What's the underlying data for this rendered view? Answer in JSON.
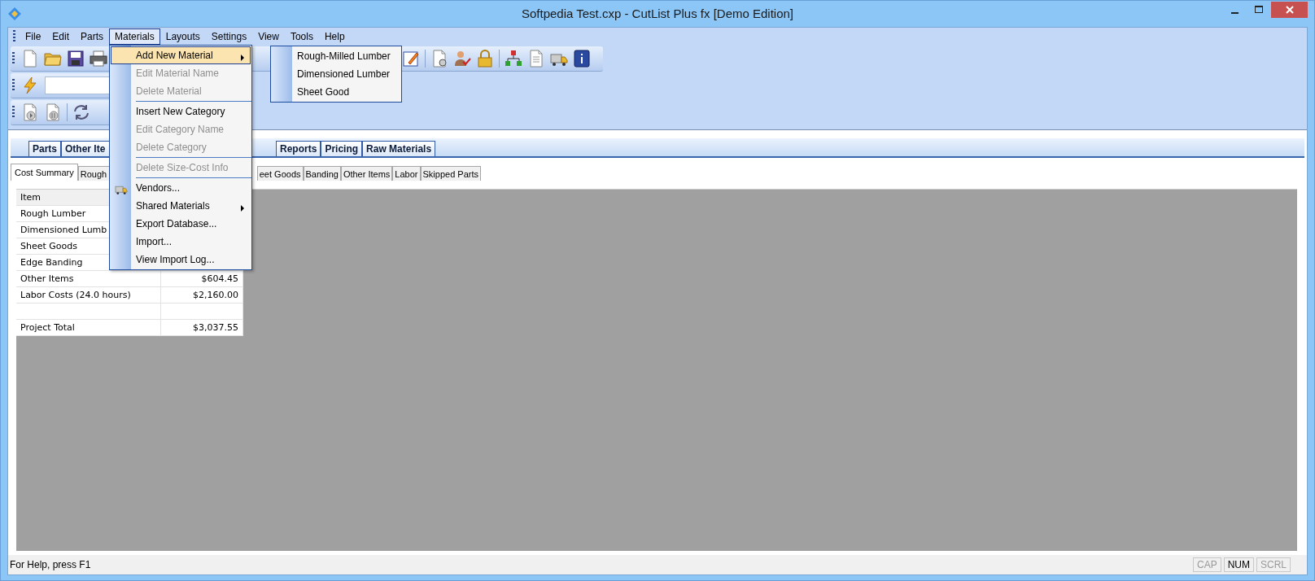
{
  "window": {
    "title": "Softpedia Test.cxp - CutList Plus fx [Demo Edition]"
  },
  "menu_bar": [
    {
      "label": "File",
      "selected": false
    },
    {
      "label": "Edit",
      "selected": false
    },
    {
      "label": "Parts",
      "selected": false
    },
    {
      "label": "Materials",
      "selected": true
    },
    {
      "label": "Layouts",
      "selected": false
    },
    {
      "label": "Settings",
      "selected": false
    },
    {
      "label": "View",
      "selected": false
    },
    {
      "label": "Tools",
      "selected": false
    },
    {
      "label": "Help",
      "selected": false
    }
  ],
  "materials_menu": {
    "items": [
      {
        "kind": "item",
        "label": "Add New Material",
        "disabled": false,
        "submenu": true,
        "selected": true
      },
      {
        "kind": "item",
        "label": "Edit Material Name",
        "disabled": true,
        "submenu": false,
        "selected": false
      },
      {
        "kind": "item",
        "label": "Delete Material",
        "disabled": true,
        "submenu": false,
        "selected": false
      },
      {
        "kind": "separator"
      },
      {
        "kind": "item",
        "label": "Insert New Category",
        "disabled": false,
        "submenu": false,
        "selected": false
      },
      {
        "kind": "item",
        "label": "Edit Category Name",
        "disabled": true,
        "submenu": false,
        "selected": false
      },
      {
        "kind": "item",
        "label": "Delete Category",
        "disabled": true,
        "submenu": false,
        "selected": false
      },
      {
        "kind": "separator"
      },
      {
        "kind": "item",
        "label": "Delete Size-Cost Info",
        "disabled": true,
        "submenu": false,
        "selected": false
      },
      {
        "kind": "separator"
      },
      {
        "kind": "icon-item",
        "label": "Vendors...",
        "disabled": false,
        "submenu": false,
        "selected": false
      },
      {
        "kind": "item",
        "label": "Shared Materials",
        "disabled": false,
        "submenu": true,
        "selected": false
      },
      {
        "kind": "item",
        "label": "Export Database...",
        "disabled": false,
        "submenu": false,
        "selected": false
      },
      {
        "kind": "item",
        "label": "Import...",
        "disabled": false,
        "submenu": false,
        "selected": false
      },
      {
        "kind": "item",
        "label": "View Import Log...",
        "disabled": false,
        "submenu": false,
        "selected": false
      }
    ],
    "submenu": [
      "Rough-Milled Lumber",
      "Dimensioned Lumber",
      "Sheet Good"
    ]
  },
  "main_tabs": [
    "Parts",
    "Other Ite",
    "Reports",
    "Pricing",
    "Raw Materials"
  ],
  "sub_tabs": [
    {
      "label": "Cost Summary",
      "selected": true
    },
    {
      "label": "Rough",
      "selected": false
    },
    {
      "label": "eet Goods",
      "selected": false
    },
    {
      "label": "Banding",
      "selected": false
    },
    {
      "label": "Other Items",
      "selected": false
    },
    {
      "label": "Labor",
      "selected": false
    },
    {
      "label": "Skipped Parts",
      "selected": false
    }
  ],
  "cost_table": {
    "header": "Item",
    "rows": [
      {
        "item": "Rough Lumber"
      },
      {
        "item": "Dimensioned Lumb"
      },
      {
        "item": "Sheet Goods"
      },
      {
        "item": "Edge Banding"
      },
      {
        "item": "Other Items",
        "cost": "$604.45"
      },
      {
        "item": "Labor Costs (24.0 hours)",
        "cost": "$2,160.00"
      },
      {},
      {
        "item": "Project Total",
        "cost": "$3,037.55"
      }
    ]
  },
  "status_bar": {
    "text": "For Help, press F1",
    "indicators": [
      {
        "label": "CAP",
        "on": false
      },
      {
        "label": "NUM",
        "on": true
      },
      {
        "label": "SCRL",
        "on": false
      }
    ]
  }
}
